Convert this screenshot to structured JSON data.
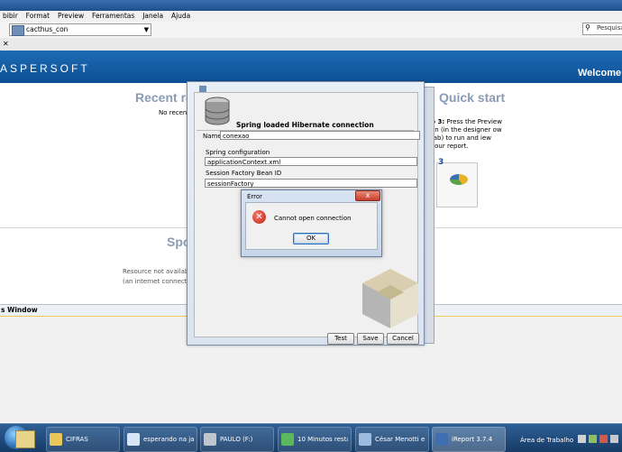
{
  "menubar": {
    "items": [
      "bibir",
      "Format",
      "Preview",
      "Ferramentas",
      "Janela",
      "Ajuda"
    ]
  },
  "toolbar": {
    "project_combo": "cacthus_con",
    "search_placeholder": "Pesquisar"
  },
  "banner": {
    "brand": "ASPERSOFT",
    "welcome": "Welcome"
  },
  "welcome_page": {
    "recent_heading": "Recent re",
    "no_recent": "No recent fi",
    "quick_heading": "Quick start",
    "step3_bold": "p 3:",
    "step3_text": "Press the Preview on (in the designer ow tab) to run and iew your report.",
    "thumb_number": "3",
    "spot_heading": "Spo",
    "resource_line1": "Resource not available",
    "resource_line2": "(an internet connection i"
  },
  "output_window": {
    "title": "s Window"
  },
  "connection_dialog": {
    "title": "Spring loaded Hibernate connection",
    "name_label": "Name",
    "name_value": "conexao",
    "spring_label": "Spring configuration",
    "spring_value": "applicationContext.xml",
    "bean_label": "Session Factory Bean ID",
    "bean_value": "sessionFactory",
    "test_button": "Test",
    "save_button": "Save",
    "cancel_button": "Cancel"
  },
  "error_dialog": {
    "title": "Error",
    "close_glyph": "x",
    "message": "Cannot open connection",
    "ok_button": "OK"
  },
  "taskbar": {
    "items": [
      {
        "label": "CIFRAS",
        "icon": "folder-icon"
      },
      {
        "label": "esperando na jan...",
        "icon": "search-icon"
      },
      {
        "label": "PAULO (F:)",
        "icon": "drive-icon"
      },
      {
        "label": "10 Minutos resta...",
        "icon": "copy-icon"
      },
      {
        "label": "César Menotti e ...",
        "icon": "document-icon"
      },
      {
        "label": "iReport 3.7.4",
        "icon": "ireport-icon"
      }
    ],
    "desktop": "Área de Trabalho"
  },
  "colors": {
    "banner": "#0d4f95",
    "heading": "#8a9bb5",
    "error_red": "#c41f12"
  }
}
